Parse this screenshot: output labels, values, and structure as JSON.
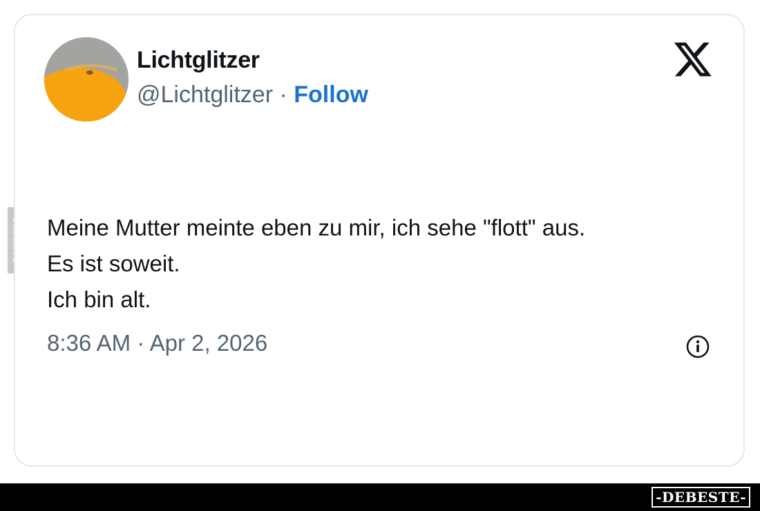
{
  "tweet": {
    "author_name": "Lichtglitzer",
    "author_handle": "@Lichtglitzer",
    "separator": "·",
    "follow_label": "Follow",
    "text_lines": [
      "Meine Mutter meinte eben zu mir, ich sehe \"flott\" aus.",
      "Es ist soweit.",
      "Ich bin alt."
    ],
    "timestamp": "8:36 AM · Apr 2, 2026"
  },
  "icons": {
    "platform_logo": "x-logo-icon",
    "info": "info-icon"
  },
  "watermark": {
    "side_tag": "DEBESTE",
    "footer_logo": "-DEBESTE-"
  },
  "colors": {
    "follow_blue": "#1d73c9",
    "text_primary": "#0f1419",
    "text_secondary": "#536471",
    "card_border": "#e6e8ea",
    "avatar_orange": "#f5a30f"
  }
}
